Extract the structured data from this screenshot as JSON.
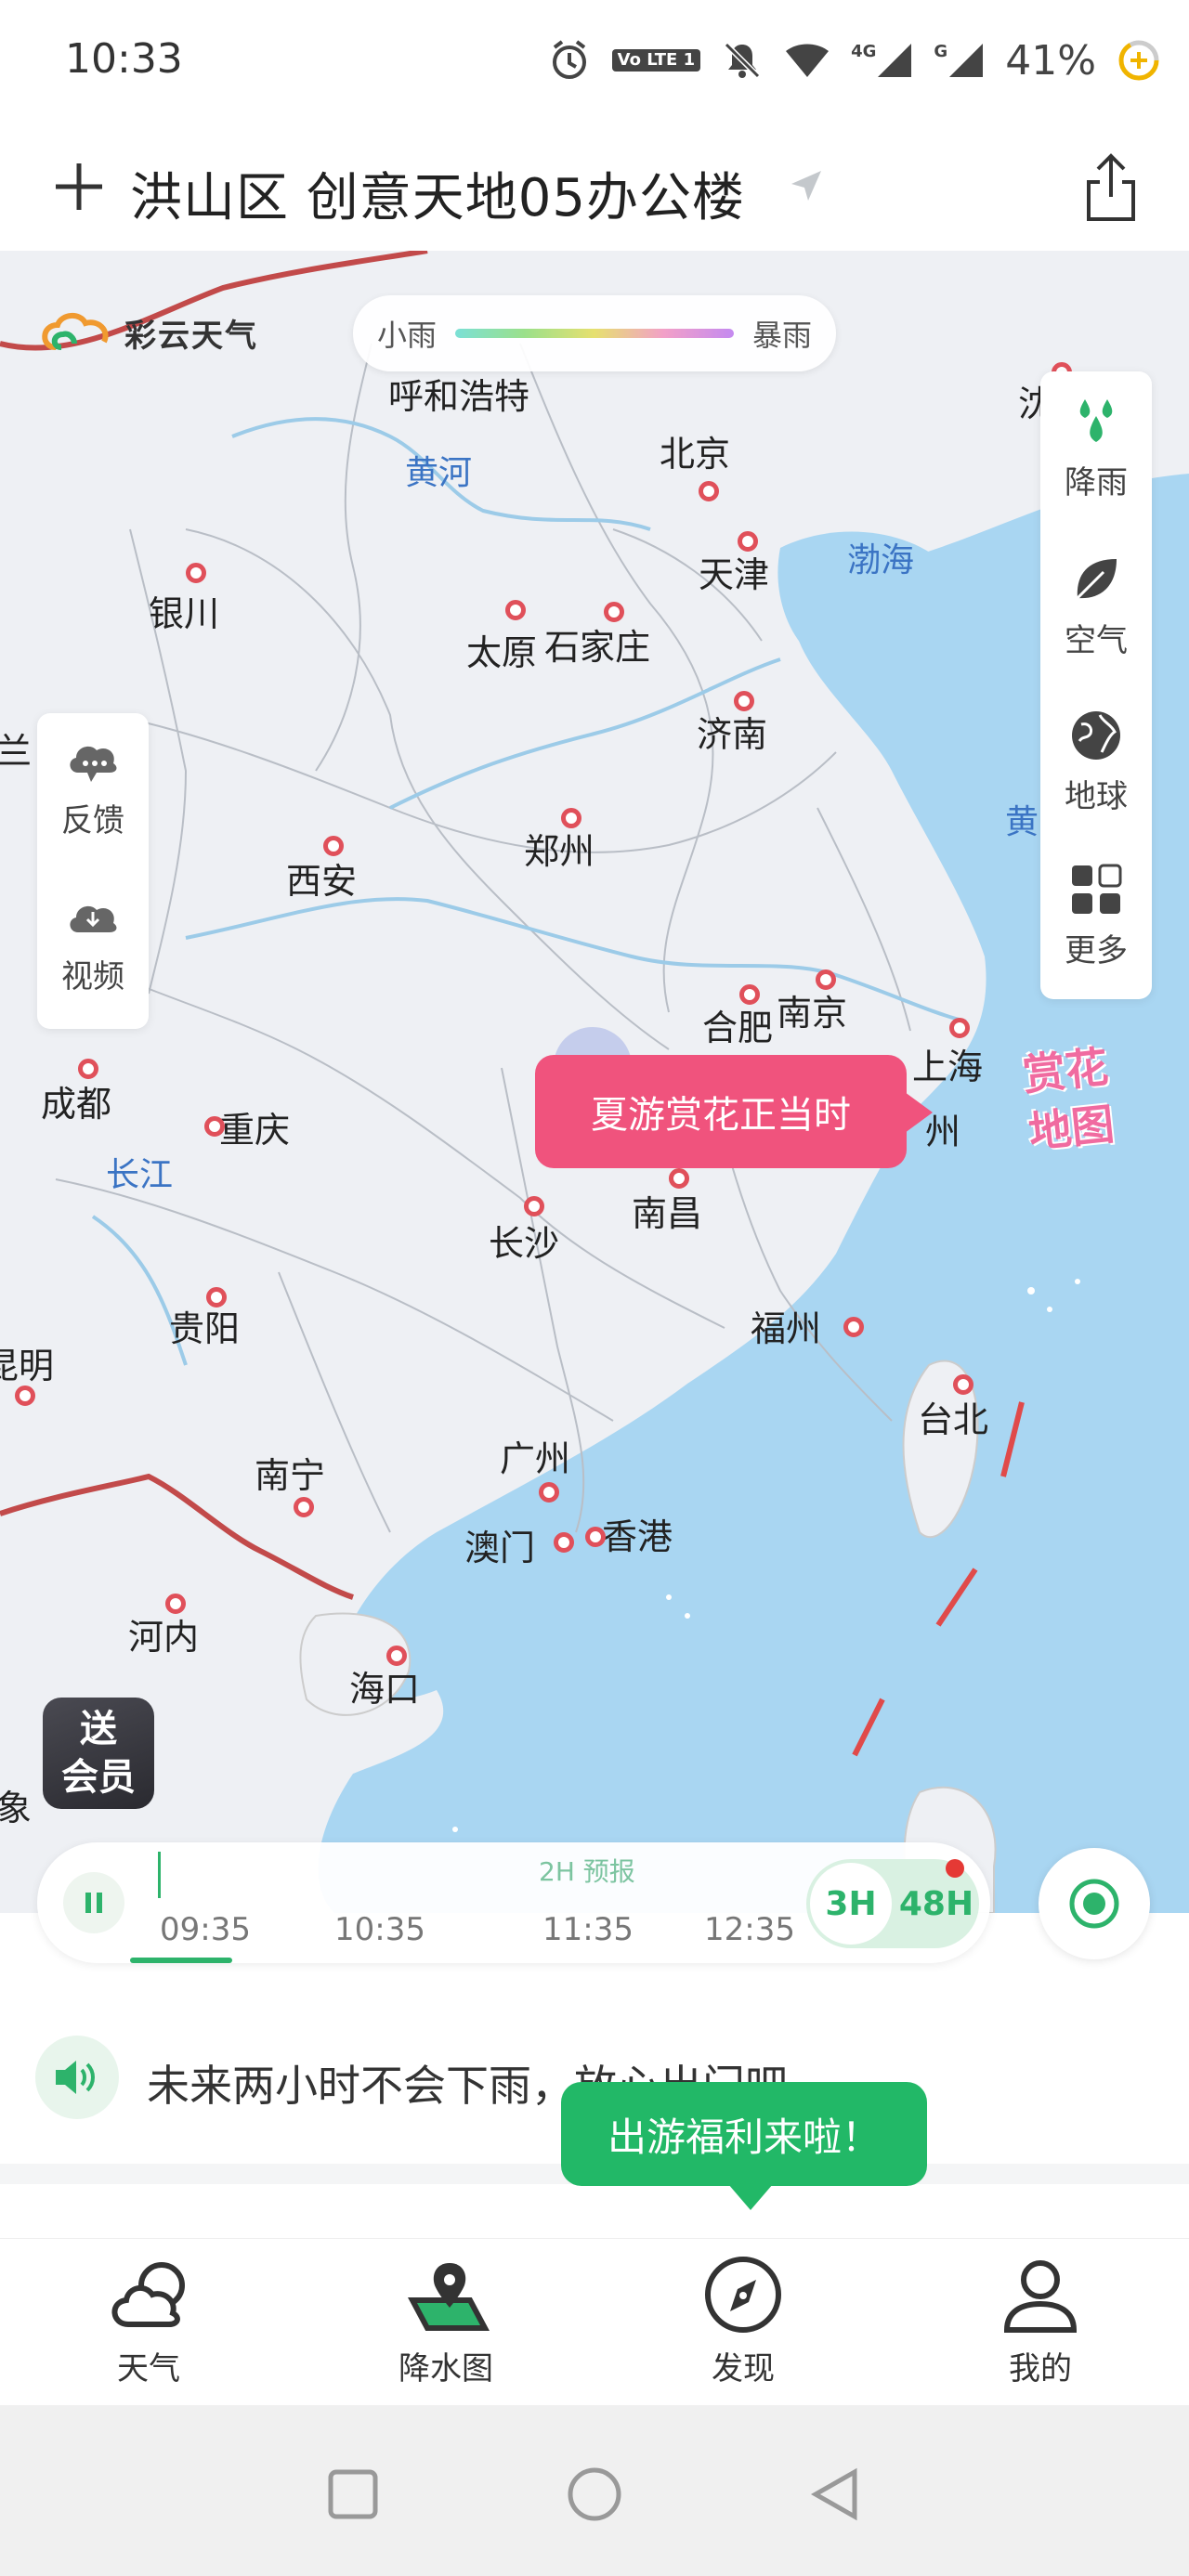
{
  "status_bar": {
    "time": "10:33",
    "battery": "41%",
    "network_1": "4G",
    "network_2": "G",
    "volte": "Vo LTE 1"
  },
  "header": {
    "add_icon": "plus-icon",
    "location": "洪山区 创意天地05办公楼",
    "share_icon": "share-icon"
  },
  "map": {
    "logo": "彩云天气",
    "legend": {
      "min_label": "小雨",
      "max_label": "暴雨"
    },
    "cities": [
      {
        "name": "呼和浩特"
      },
      {
        "name": "北京"
      },
      {
        "name": "天津"
      },
      {
        "name": "银川"
      },
      {
        "name": "太原"
      },
      {
        "name": "石家庄"
      },
      {
        "name": "济南"
      },
      {
        "name": "郑州"
      },
      {
        "name": "西安"
      },
      {
        "name": "合肥"
      },
      {
        "name": "南京"
      },
      {
        "name": "上海"
      },
      {
        "name": "成都"
      },
      {
        "name": "重庆"
      },
      {
        "name": "长沙"
      },
      {
        "name": "南昌"
      },
      {
        "name": "贵阳"
      },
      {
        "name": "福州"
      },
      {
        "name": "台北"
      },
      {
        "name": "昆明"
      },
      {
        "name": "南宁"
      },
      {
        "name": "广州"
      },
      {
        "name": "澳门"
      },
      {
        "name": "香港"
      },
      {
        "name": "河内"
      },
      {
        "name": "海口"
      },
      {
        "name": "沈"
      }
    ],
    "water_labels": {
      "yellow_river": "黄河",
      "bohai": "渤海",
      "yangtze": "长江",
      "yellow_sea": "黄"
    },
    "edge_labels": {
      "left_top": "兰",
      "left_bottom": "象",
      "shanghai_suffix": "州"
    },
    "side_right": [
      {
        "label": "降雨",
        "icon": "rain-drops-icon"
      },
      {
        "label": "空气",
        "icon": "leaf-icon"
      },
      {
        "label": "地球",
        "icon": "globe-icon"
      },
      {
        "label": "更多",
        "icon": "grid-icon"
      }
    ],
    "side_left": [
      {
        "label": "反馈",
        "icon": "feedback-cloud-icon"
      },
      {
        "label": "视频",
        "icon": "download-cloud-icon"
      }
    ],
    "promo_bubble": "夏游赏花正当时",
    "flower_map_line1": "赏花",
    "flower_map_line2": "地图",
    "member_badge_line1": "送",
    "member_badge_line2": "会员"
  },
  "timeline": {
    "forecast_label": "2H 预报",
    "ticks": [
      "09:35",
      "10:35",
      "11:35",
      "12:35"
    ],
    "mode_3h": "3H",
    "mode_48h": "48H",
    "progress": 0.1
  },
  "notice": {
    "text": "未来两小时不会下雨，放心出门吧"
  },
  "welfare_bubble": "出游福利来啦！",
  "bottom_nav": [
    {
      "label": "天气",
      "icon": "cloud-icon"
    },
    {
      "label": "降水图",
      "icon": "map-pin-icon"
    },
    {
      "label": "发现",
      "icon": "compass-icon"
    },
    {
      "label": "我的",
      "icon": "person-icon"
    }
  ],
  "colors": {
    "accent_green": "#22b867",
    "promo_pink": "#f0537d",
    "sea_blue": "#a9d6f2"
  }
}
